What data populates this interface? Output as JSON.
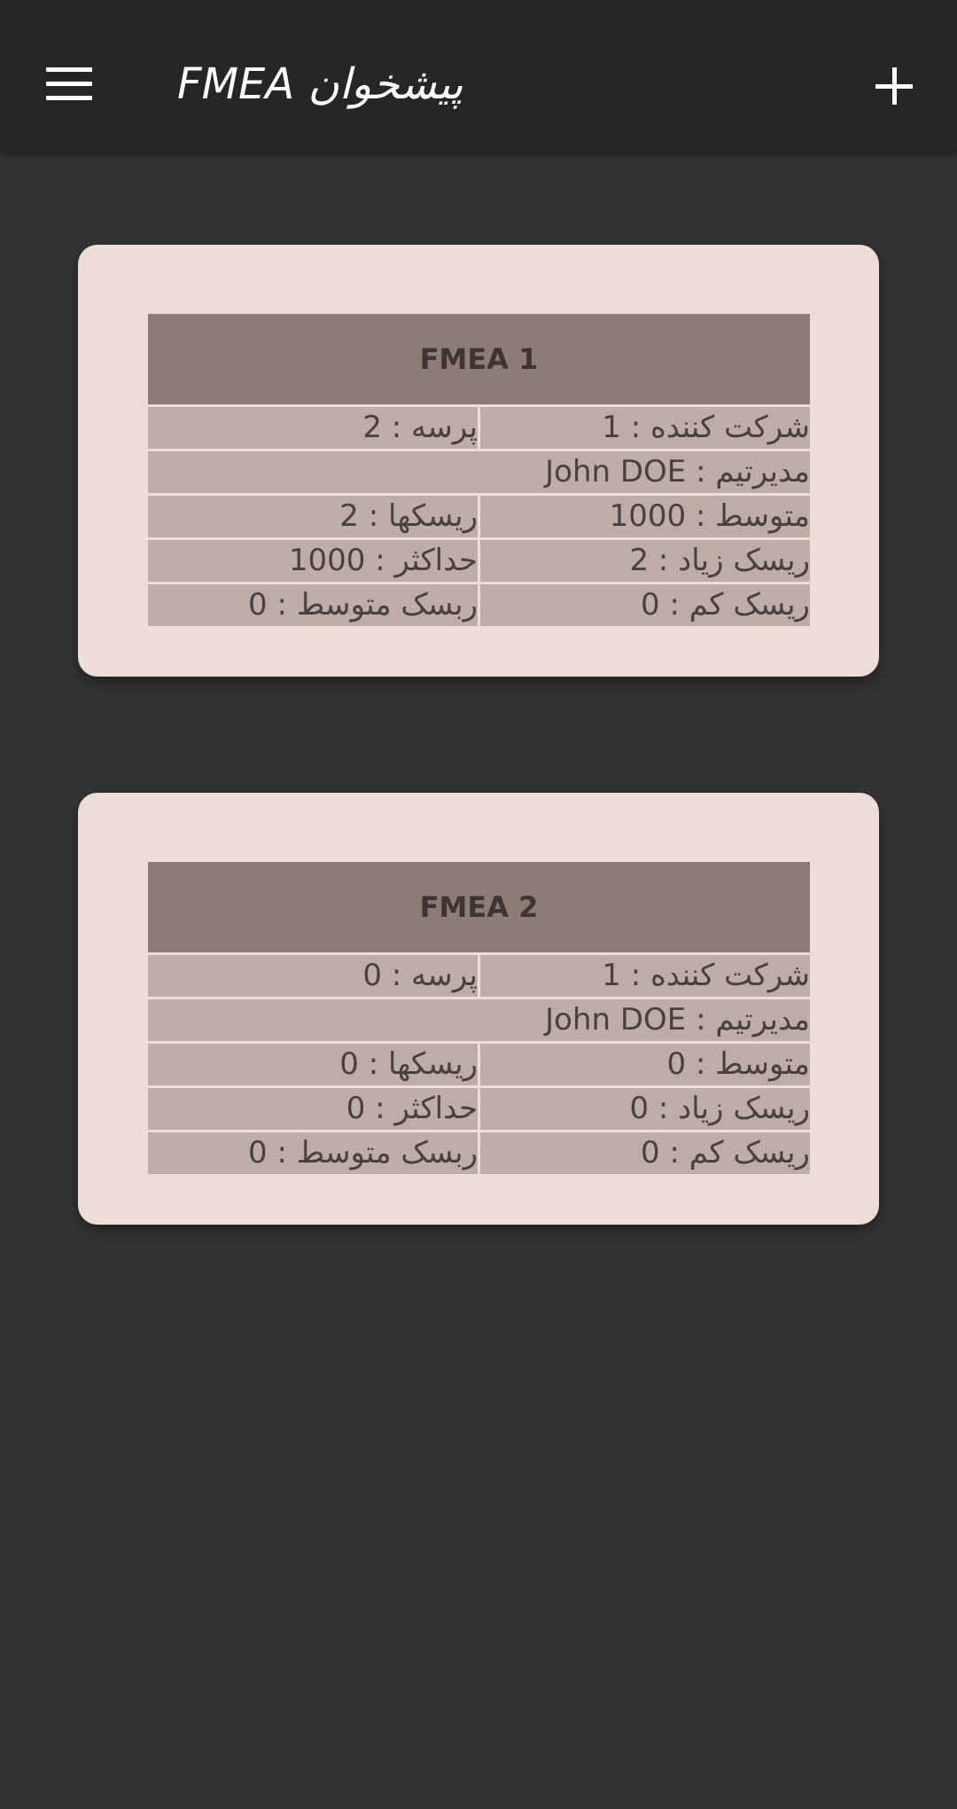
{
  "app_bar": {
    "title": "پیشخوان FMEA",
    "menu_icon": "hamburger-menu-icon",
    "add_icon": "plus-icon"
  },
  "colors": {
    "background": "#333333",
    "app_bar": "#262626",
    "card": "#eeddd6",
    "table_header": "#8c7c75",
    "table_cell": "#bdada6"
  },
  "cards": [
    {
      "title": "FMEA 1",
      "participants": "شرکت کننده : 1",
      "processes": "پرسه : 2",
      "team_manager": "مدیرتیم : John DOE",
      "average": "متوسط : 1000",
      "risks": "ریسکها : 2",
      "high_risk": "ریسک زیاد : 2",
      "maximum": "حداکثر : 1000",
      "low_risk": "ریسک کم : 0",
      "medium_risk": "ربسک متوسط : 0"
    },
    {
      "title": "FMEA 2",
      "participants": "شرکت کننده : 1",
      "processes": "پرسه : 0",
      "team_manager": "مدیرتیم : John DOE",
      "average": "متوسط : 0",
      "risks": "ریسکها : 0",
      "high_risk": "ریسک زیاد : 0",
      "maximum": "حداکثر : 0",
      "low_risk": "ریسک کم : 0",
      "medium_risk": "ربسک متوسط : 0"
    }
  ]
}
